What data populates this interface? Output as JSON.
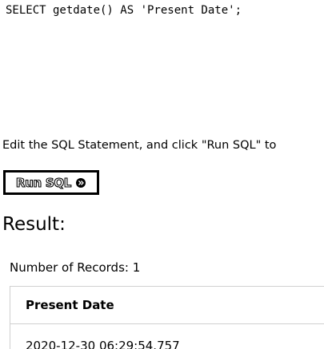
{
  "editor": {
    "sql": "SELECT getdate() AS 'Present Date';"
  },
  "instructions": "Edit the SQL Statement, and click \"Run SQL\" to",
  "run_button": {
    "label": "Run SQL",
    "icon": "double-chevron-right-icon"
  },
  "result": {
    "heading": "Result:",
    "record_count": "Number of Records: 1",
    "columns": [
      "Present Date"
    ],
    "rows": [
      [
        "2020-12-30 06:29:54.757"
      ]
    ]
  }
}
